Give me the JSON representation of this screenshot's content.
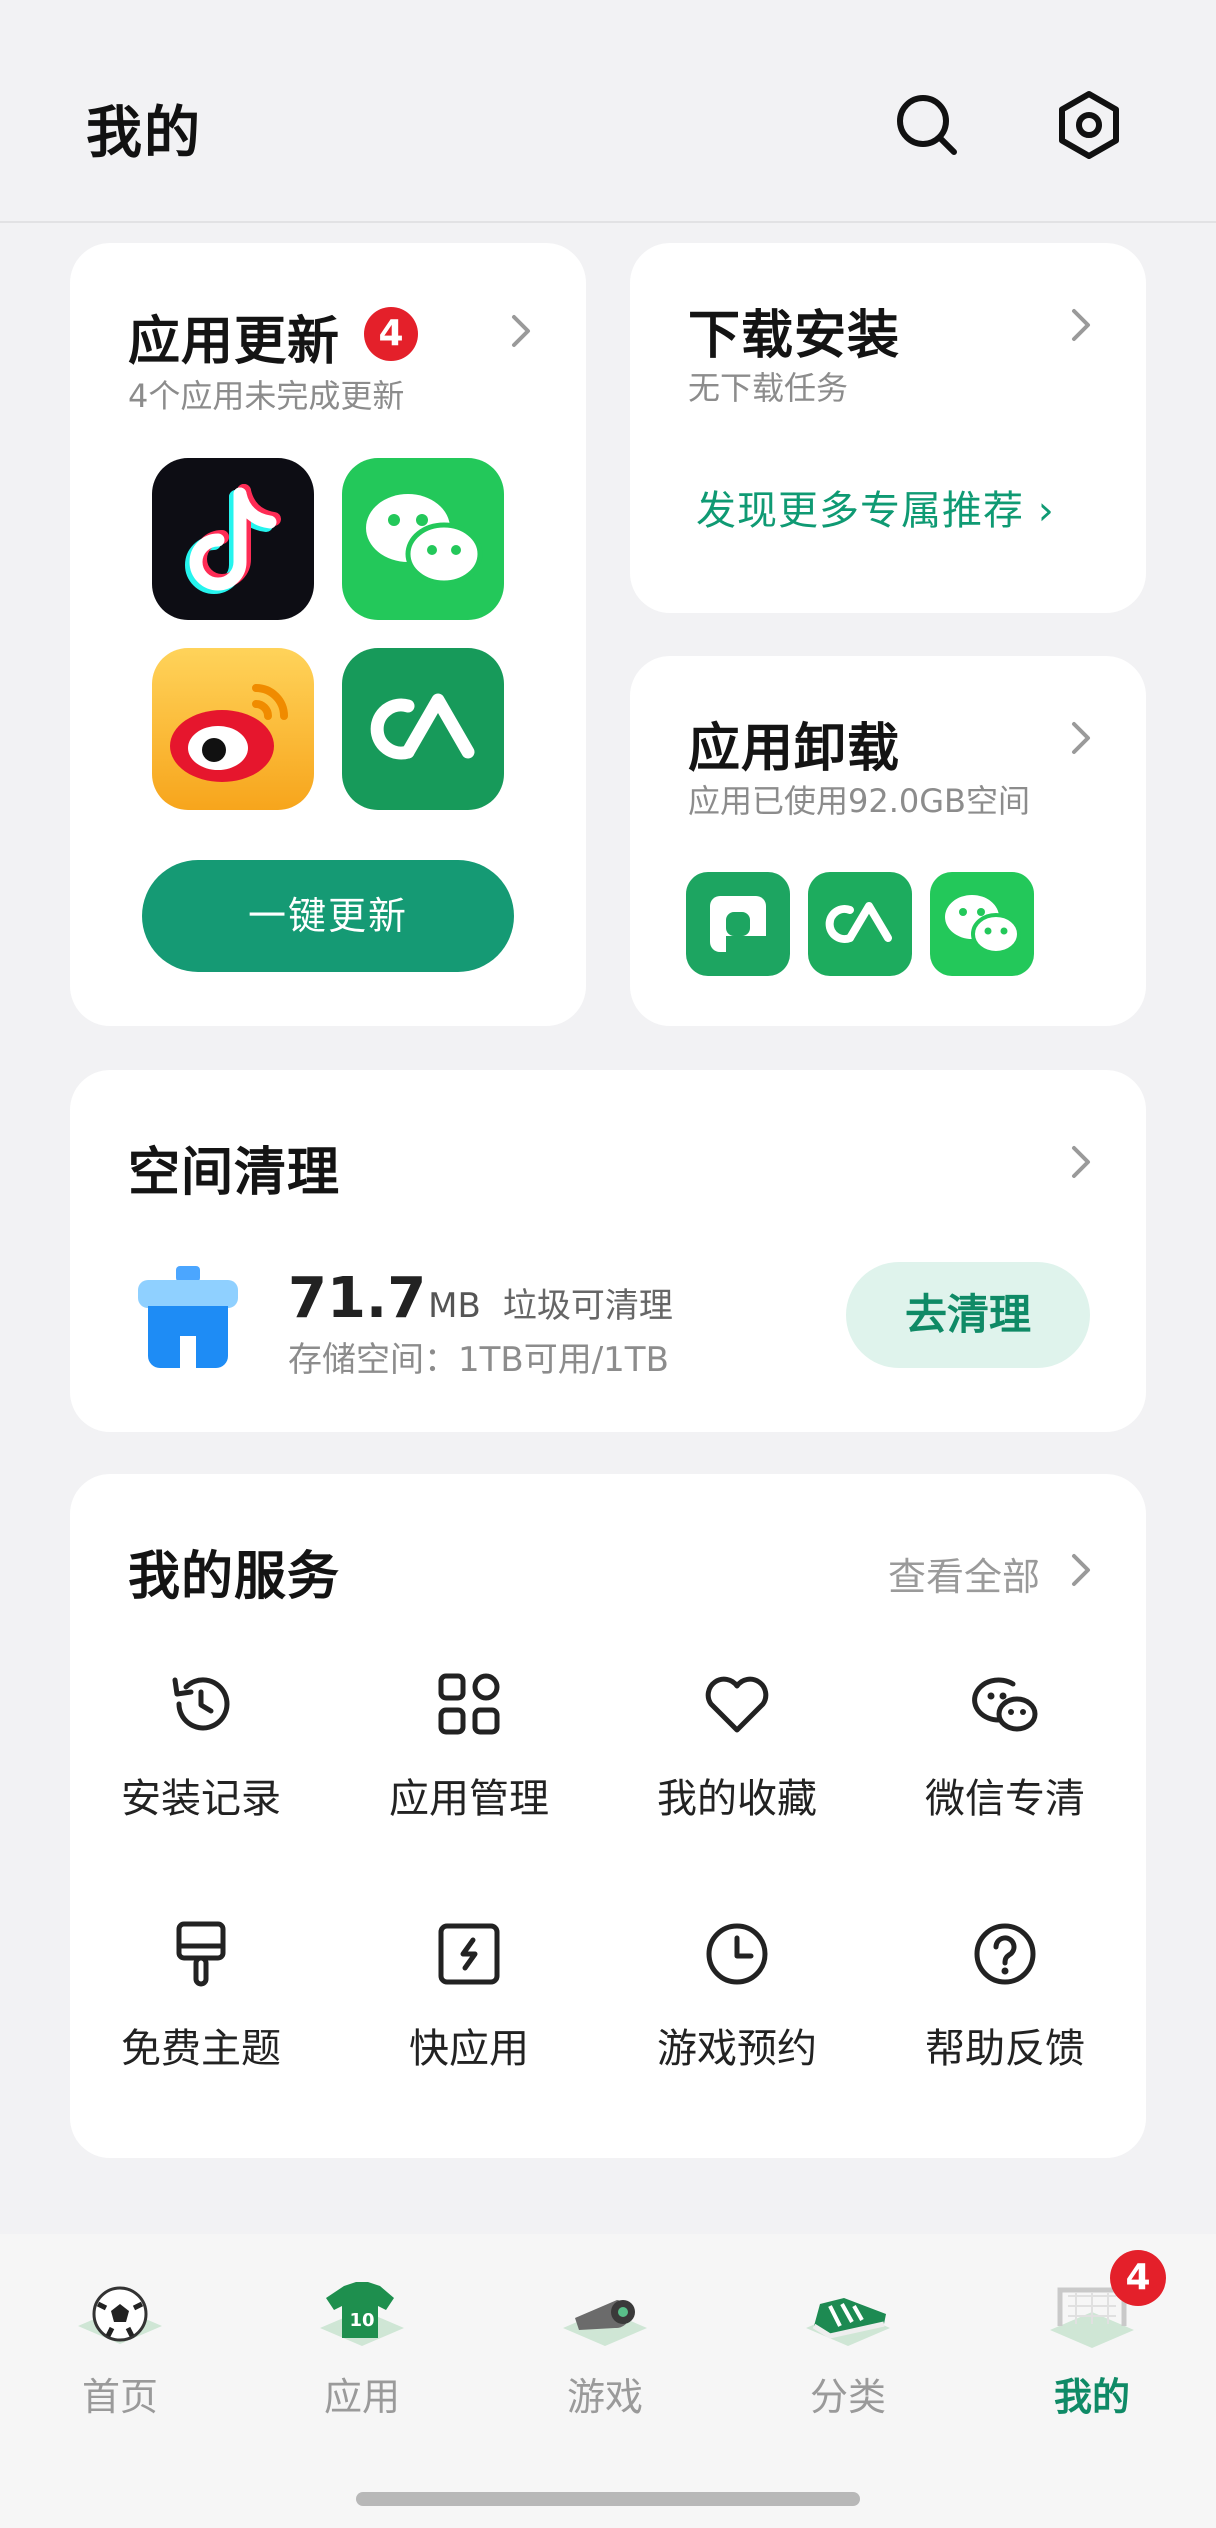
{
  "header": {
    "title": "我的",
    "search_icon": "search-icon",
    "settings_icon": "settings-hexagon-icon"
  },
  "app_update": {
    "title": "应用更新",
    "badge": "4",
    "subtitle": "4个应用未完成更新",
    "apps": [
      "douyin-app-icon",
      "wechat-app-icon",
      "weibo-app-icon",
      "cooperation-app-icon"
    ],
    "button": "一键更新"
  },
  "download": {
    "title": "下载安装",
    "subtitle": "无下载任务",
    "link": "发现更多专属推荐 ›"
  },
  "uninstall": {
    "title": "应用卸载",
    "subtitle": "应用已使用92.0GB空间",
    "apps": [
      "frame-app-icon",
      "cooperation-app-icon",
      "wechat-app-icon"
    ]
  },
  "space_clean": {
    "title": "空间清理",
    "size_value": "71.7",
    "size_unit": "MB",
    "size_desc": "垃圾可清理",
    "storage": "存储空间：1TB可用/1TB",
    "button": "去清理",
    "icon": "trash-icon"
  },
  "services": {
    "title": "我的服务",
    "view_all": "查看全部",
    "items": [
      {
        "label": "安装记录",
        "icon": "history-icon"
      },
      {
        "label": "应用管理",
        "icon": "grid-icon"
      },
      {
        "label": "我的收藏",
        "icon": "heart-icon"
      },
      {
        "label": "微信专清",
        "icon": "wechat-outline-icon"
      },
      {
        "label": "免费主题",
        "icon": "brush-icon"
      },
      {
        "label": "快应用",
        "icon": "quick-app-icon"
      },
      {
        "label": "游戏预约",
        "icon": "clock-icon"
      },
      {
        "label": "帮助反馈",
        "icon": "help-icon"
      }
    ]
  },
  "bottom_nav": {
    "items": [
      {
        "label": "首页",
        "icon": "soccer-ball-icon"
      },
      {
        "label": "应用",
        "icon": "jersey-icon"
      },
      {
        "label": "游戏",
        "icon": "whistle-icon"
      },
      {
        "label": "分类",
        "icon": "sneaker-icon"
      },
      {
        "label": "我的",
        "icon": "goal-net-icon",
        "badge": "4",
        "active": true
      }
    ]
  },
  "colors": {
    "accent": "#0f9a73",
    "badge": "#e4202a",
    "background": "#f2f2f4"
  }
}
